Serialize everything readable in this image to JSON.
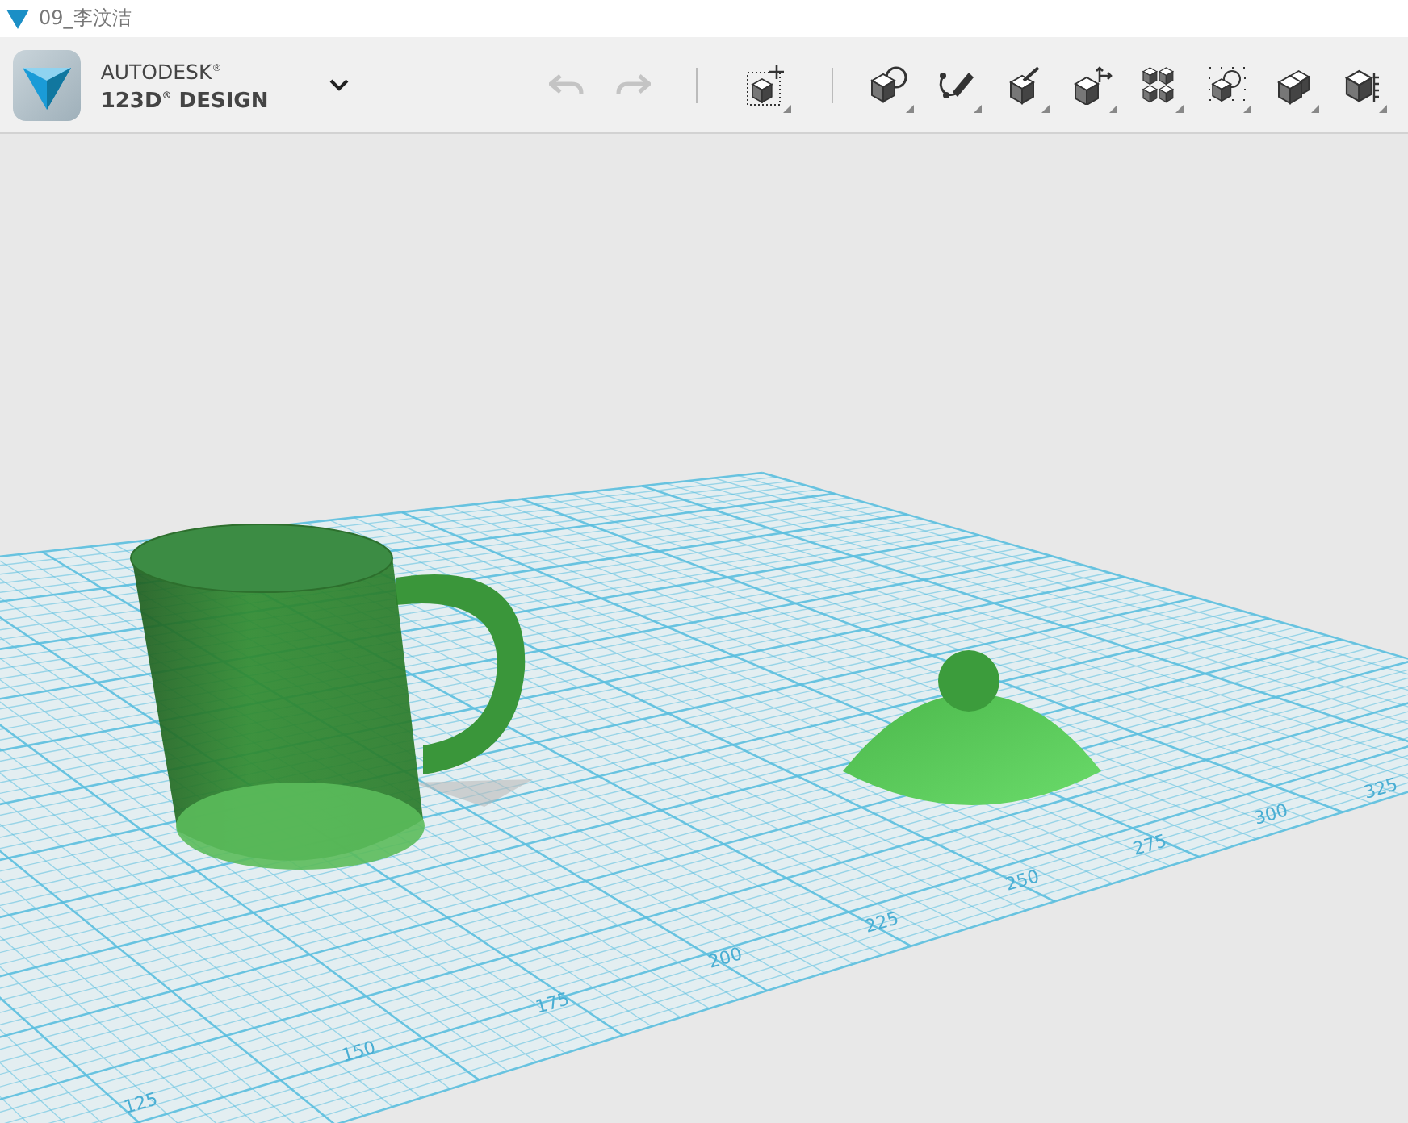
{
  "window": {
    "title": "09_李汶洁"
  },
  "header": {
    "brand": "AUTODESK$^{®}$",
    "product": "123D$^{®}$ DESIGN"
  },
  "toolbar": {
    "undo": {
      "disabled": true
    },
    "redo": {
      "disabled": true
    }
  },
  "grid": {
    "ruler_labels": [
      "125",
      "150",
      "175",
      "200",
      "225",
      "250",
      "275",
      "300",
      "325"
    ]
  }
}
